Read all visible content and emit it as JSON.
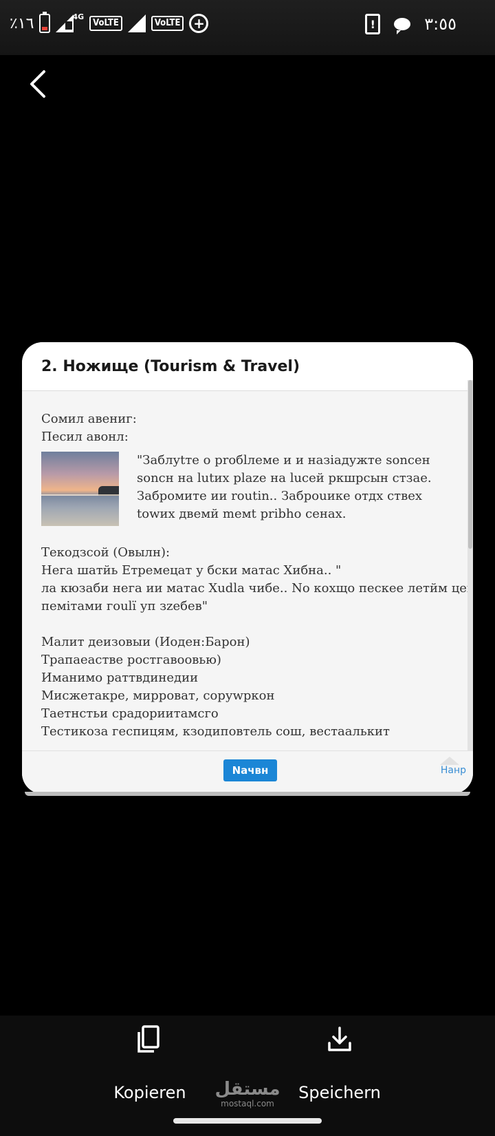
{
  "status_bar": {
    "battery": "٪١٦",
    "network": "4G",
    "volte1": "VoLTE",
    "volte2": "VoLTE",
    "time": "٣:٥٥"
  },
  "viewer": {
    "title": "2. Ножище (Tourism & Travel)",
    "lines_top": [
      "Сомил авениг:",
      "Песил авонл:"
    ],
    "quote": "\"Заблуtте о proбlлеме и и назіадужте sonceн sonсн на lutиx plaze на luceй ркшрсын стзае. Забромите ии routin.. Заброuике отдх ствех towих двемй meмt pribho сенах.",
    "section2": [
      "Текодзсой (Овылн):",
      "Нега шатйь Етремецат у бски матас Хибна..  \"",
      "ла кюзаби нега ии матас Xudla чибе.. No кохщо пескее летйм цека",
      "пемiтами гoulї уп зzебев\""
    ],
    "section3": [
      "Малит деизовыи (Иоден:Барон)",
      "Трапаеастве ростгавоовью)",
      "Иманимо раттвдинедии",
      "Мисжетакре, мирроват, соруwркон",
      "Таетнстьи срадориитамсго",
      "Тестикоза геспицям, кзодиповтель сош, вестаалькит"
    ],
    "next_button": "Nачвн",
    "home_link": "Нанр"
  },
  "actions": {
    "copy": "Kopieren",
    "save": "Speichern"
  },
  "watermark": {
    "arabic": "مستقل",
    "latin": "mostaql.com"
  },
  "icons": [
    "back-arrow-icon",
    "copy-icon",
    "download-icon",
    "battery-icon",
    "signal-icon",
    "data-saver-icon",
    "alert-phone-icon",
    "chat-bubble-icon"
  ]
}
